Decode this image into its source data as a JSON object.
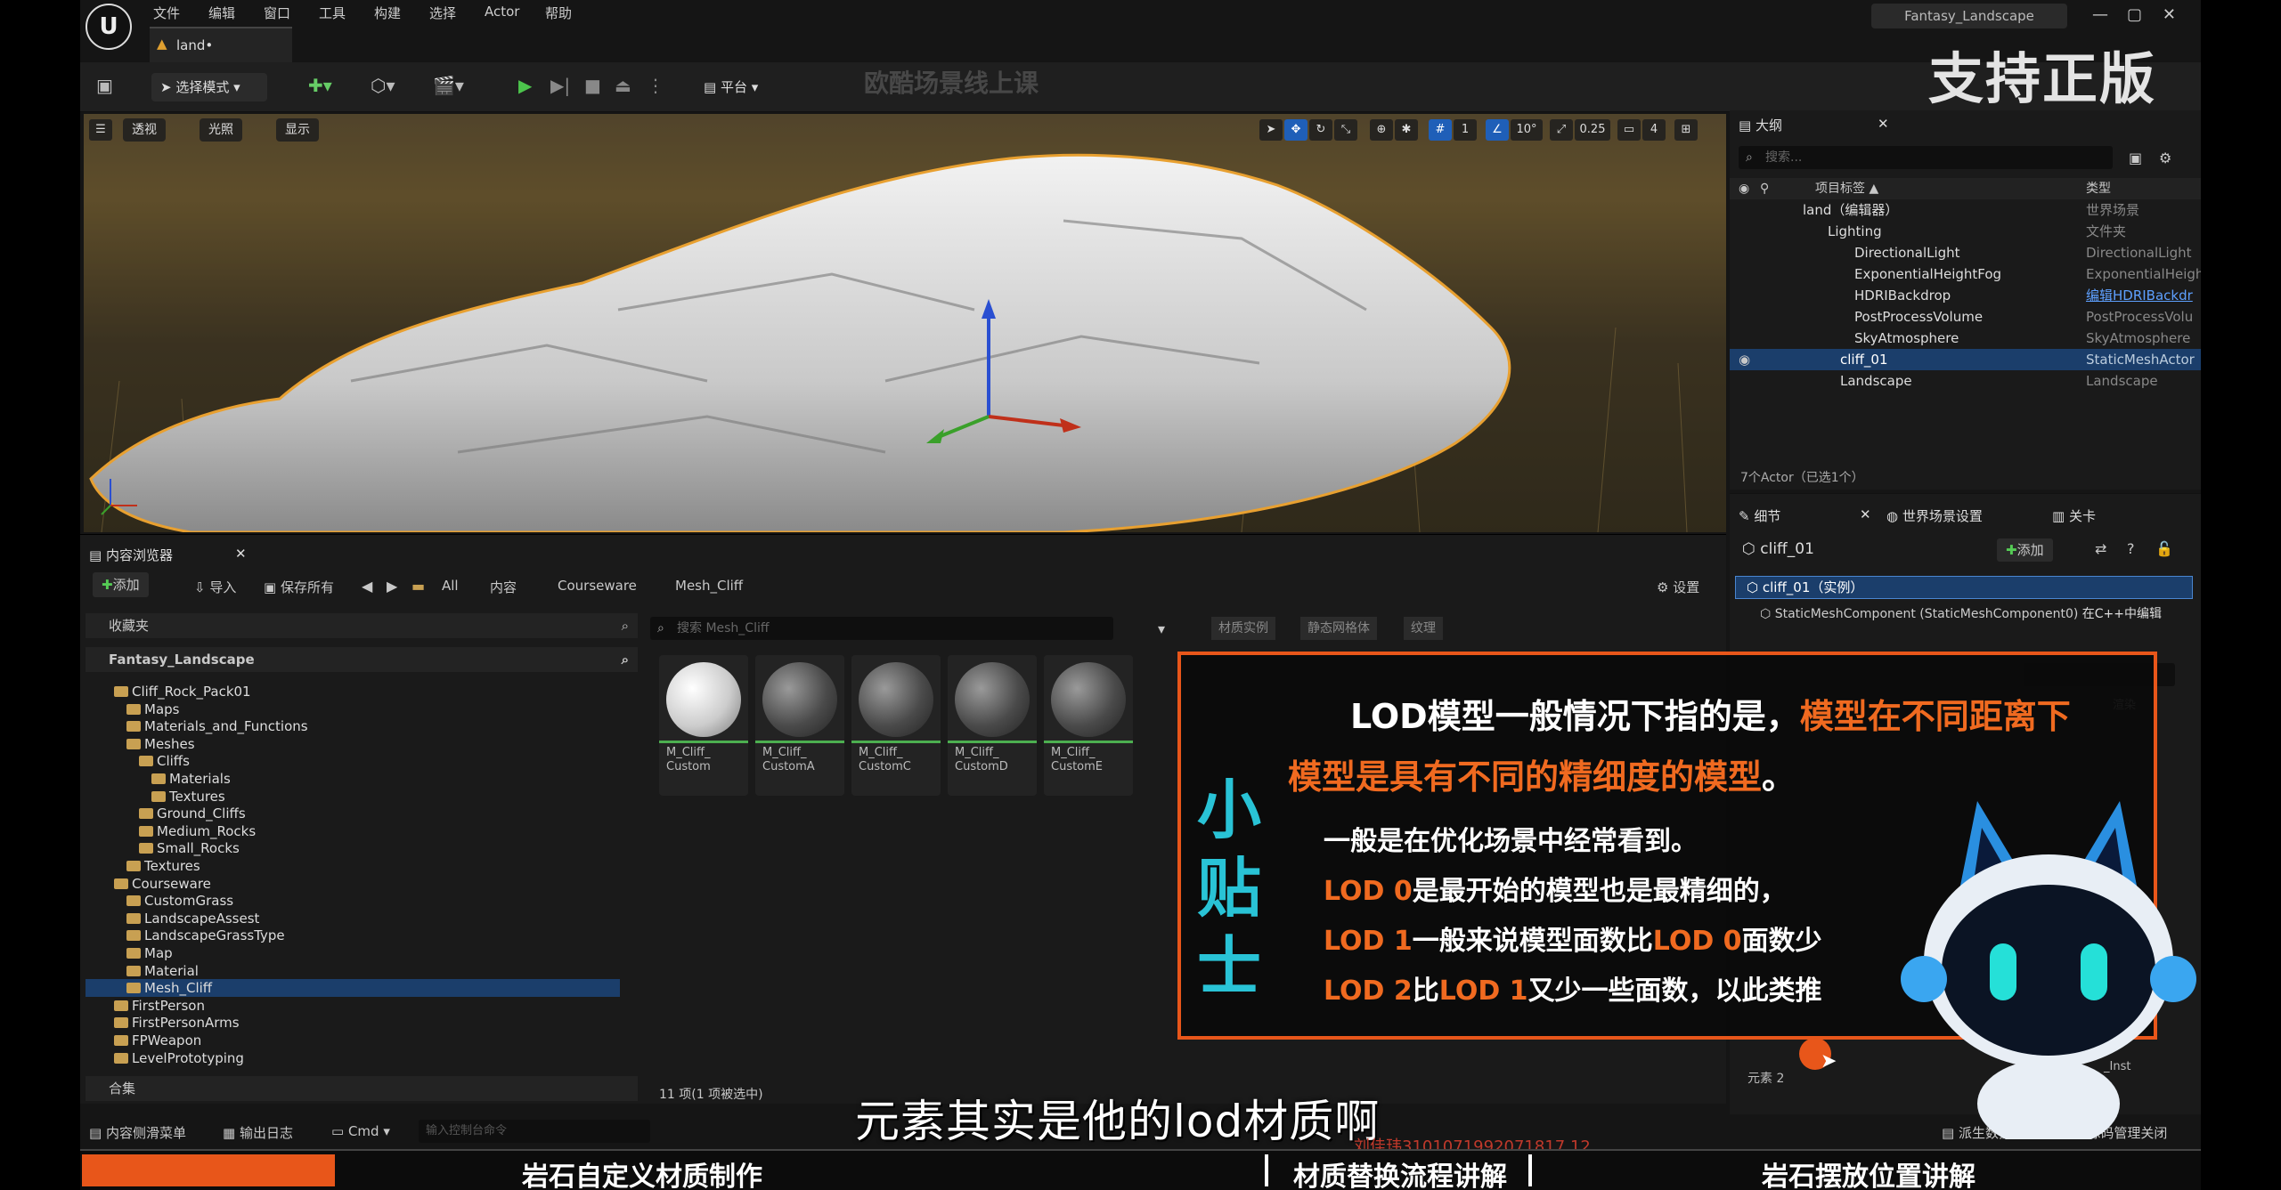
{
  "menu": {
    "items": [
      "文件",
      "编辑",
      "窗口",
      "工具",
      "构建",
      "选择",
      "Actor",
      "帮助"
    ],
    "doc_tab": "land•",
    "window_title": "Fantasy_Landscape",
    "brand": "支持正版"
  },
  "toolbar": {
    "select_mode": "选择模式",
    "platform": "平台",
    "watermark_course": "欧酷场景线上课"
  },
  "viewport": {
    "perspective": "透视",
    "lighting": "光照",
    "show": "显示",
    "grid_value": "1",
    "angle_value": "10°",
    "scale_value": "0.25",
    "camera_value": "4"
  },
  "outliner": {
    "tab": "大纲",
    "search_placeholder": "搜索...",
    "col_label": "项目标签 ▲",
    "col_type": "类型",
    "rows": [
      {
        "name": "land（编辑器）",
        "type": "世界场景"
      },
      {
        "name": "Lighting",
        "type": "文件夹"
      },
      {
        "name": "DirectionalLight",
        "type": "DirectionalLight"
      },
      {
        "name": "ExponentialHeightFog",
        "type": "ExponentialHeigh"
      },
      {
        "name": "HDRIBackdrop",
        "type": "编辑HDRIBackdr"
      },
      {
        "name": "PostProcessVolume",
        "type": "PostProcessVolu"
      },
      {
        "name": "SkyAtmosphere",
        "type": "SkyAtmosphere"
      },
      {
        "name": "cliff_01",
        "type": "StaticMeshActor"
      },
      {
        "name": "Landscape",
        "type": "Landscape"
      }
    ],
    "footer": "7个Actor（已选1个）"
  },
  "details": {
    "tab_details": "细节",
    "tab_world": "世界场景设置",
    "tab_level": "关卡",
    "object_name": "cliff_01",
    "add_button": "添加",
    "instance_row": "cliff_01（实例）",
    "component_row": "StaticMeshComponent (StaticMeshComponent0)",
    "component_link": "在C++中编辑",
    "render_label": "渲染",
    "element_label": "元素 2",
    "inst_label": "_Inst"
  },
  "content_browser": {
    "tab": "内容浏览器",
    "add": "添加",
    "import": "导入",
    "save_all": "保存所有",
    "crumbs": [
      "All",
      "内容",
      "Courseware",
      "Mesh_Cliff"
    ],
    "settings": "设置",
    "favorites": "收藏夹",
    "project": "Fantasy_Landscape",
    "search_placeholder": "搜索 Mesh_Cliff",
    "filters": [
      "材质实例",
      "静态网格体",
      "纹理"
    ],
    "tree": [
      {
        "label": "Cliff_Rock_Pack01",
        "indent": 1
      },
      {
        "label": "Maps",
        "indent": 2
      },
      {
        "label": "Materials_and_Functions",
        "indent": 2
      },
      {
        "label": "Meshes",
        "indent": 2
      },
      {
        "label": "Cliffs",
        "indent": 3
      },
      {
        "label": "Materials",
        "indent": 4
      },
      {
        "label": "Textures",
        "indent": 4
      },
      {
        "label": "Ground_Cliffs",
        "indent": 3
      },
      {
        "label": "Medium_Rocks",
        "indent": 3
      },
      {
        "label": "Small_Rocks",
        "indent": 3
      },
      {
        "label": "Textures",
        "indent": 2
      },
      {
        "label": "Courseware",
        "indent": 1
      },
      {
        "label": "CustomGrass",
        "indent": 2
      },
      {
        "label": "LandscapeAssest",
        "indent": 2
      },
      {
        "label": "LandscapeGrassType",
        "indent": 2
      },
      {
        "label": "Map",
        "indent": 2
      },
      {
        "label": "Material",
        "indent": 2
      },
      {
        "label": "Mesh_Cliff",
        "indent": 2
      },
      {
        "label": "FirstPerson",
        "indent": 1
      },
      {
        "label": "FirstPersonArms",
        "indent": 1
      },
      {
        "label": "FPWeapon",
        "indent": 1
      },
      {
        "label": "LevelPrototyping",
        "indent": 1
      }
    ],
    "assets": [
      {
        "line1": "M_Cliff_",
        "line2": "Custom"
      },
      {
        "line1": "M_Cliff_",
        "line2": "CustomA"
      },
      {
        "line1": "M_Cliff_",
        "line2": "CustomC"
      },
      {
        "line1": "M_Cliff_",
        "line2": "CustomD"
      },
      {
        "line1": "M_Cliff_",
        "line2": "CustomE"
      }
    ],
    "collections": "合集",
    "item_count": "11 项(1 项被选中)"
  },
  "statusbar": {
    "drawer": "内容侧滑菜单",
    "output": "输出日志",
    "cmd": "Cmd",
    "cmd_placeholder": "输入控制台命令",
    "derived": "派生数据",
    "source_control": "源码管理关闭"
  },
  "tip": {
    "side_title": [
      "小",
      "贴",
      "士"
    ],
    "headline_white": "LOD模型一般情况下指的是，",
    "headline_orange": "模型在不同距离下",
    "headline2_orange": "模型是具有不同的精细度的模型",
    "headline2_white": "。",
    "line1": "一般是在优化场景中经常看到。",
    "line2_a": "LOD 0",
    "line2_b": "是最开始的模型也是最精细的，",
    "line3_a": "LOD 1",
    "line3_b": "一般来说模型面数比",
    "line3_c": "LOD 0",
    "line3_d": "面数少",
    "line4_a": "LOD 2",
    "line4_b": "比",
    "line4_c": "LOD 1",
    "line4_d": "又少一些面数，以此类推"
  },
  "subtitle": "元素其实是他的lod材质啊",
  "watermark_id": "刘佳玮3101071992071817 12",
  "bottom_nav": [
    "岩石自定义材质制作",
    "材质替换流程讲解",
    "岩石摆放位置讲解"
  ],
  "colors": {
    "accent_orange": "#e8561a",
    "tip_cyan": "#29c3d6",
    "select_blue": "#1b3e6b"
  }
}
